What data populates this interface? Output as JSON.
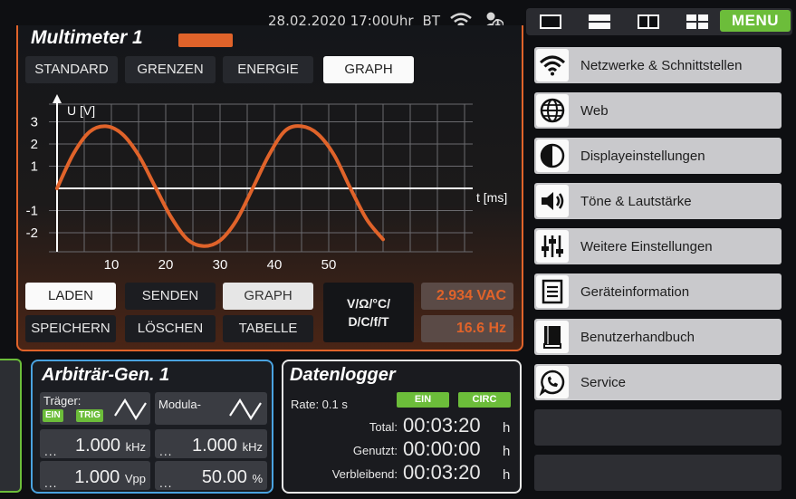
{
  "status": {
    "datetime": "28.02.2020  17:00Uhr",
    "bt": "BT",
    "user_badge": "1"
  },
  "menu_label": "MENU",
  "multimeter": {
    "title": "Multimeter 1",
    "tabs": [
      {
        "label": "STANDARD",
        "active": false
      },
      {
        "label": "GRENZEN",
        "active": false
      },
      {
        "label": "ENERGIE",
        "active": false
      },
      {
        "label": "GRAPH",
        "active": true
      }
    ],
    "graph": {
      "ylabel": "U [V]",
      "xlabel": "t [ms]",
      "y_ticks": [
        "3",
        "2",
        "1",
        "-1",
        "-2"
      ],
      "x_ticks": [
        "10",
        "20",
        "30",
        "40",
        "50"
      ]
    },
    "buttons": {
      "laden": "LADEN",
      "senden": "SENDEN",
      "graph": "GRAPH",
      "speichern": "SPEICHERN",
      "loeschen": "LÖSCHEN",
      "tabelle": "TABELLE"
    },
    "unit_select": [
      "V/Ω/°C/",
      "D/C/f/T"
    ],
    "reading_1": "2.934 VAC",
    "reading_2": "16.6 Hz"
  },
  "chart_data": {
    "type": "line",
    "xlabel": "t [ms]",
    "ylabel": "U [V]",
    "x_ticks": [
      10,
      20,
      30,
      40,
      50
    ],
    "y_ticks": [
      3,
      2,
      1,
      -1,
      -2
    ],
    "series": [
      {
        "x": [
          0,
          3,
          6,
          9,
          12,
          15,
          18,
          21,
          24,
          27,
          30,
          33,
          36,
          39,
          42,
          45,
          48,
          51,
          54,
          57,
          60
        ],
        "values": [
          0,
          1.55,
          2.55,
          2.8,
          2.45,
          1.5,
          0.1,
          -1.3,
          -2.3,
          -2.6,
          -2.35,
          -1.45,
          0,
          1.5,
          2.6,
          2.8,
          2.45,
          1.5,
          0,
          -1.4,
          -2.3
        ]
      }
    ]
  },
  "arb_gen": {
    "title": "Arbiträr-Gen. 1",
    "traeger_label": "Träger:",
    "ein": "EIN",
    "trig": "TRIG",
    "modula_label": "Modula-",
    "freq1": "1.000",
    "freq1_unit": "kHz",
    "freq2": "1.000",
    "freq2_unit": "kHz",
    "amp": "1.000",
    "amp_unit": "Vpp",
    "pct": "50.00",
    "pct_unit": "%",
    "dots": "..."
  },
  "datalogger": {
    "title": "Datenlogger",
    "rate": "Rate: 0.1 s",
    "ein": "EIN",
    "circ": "CIRC",
    "rows": [
      {
        "label": "Total:",
        "value": "00:03:20",
        "unit": "h"
      },
      {
        "label": "Genutzt:",
        "value": "00:00:00",
        "unit": "h"
      },
      {
        "label": "Verbleibend:",
        "value": "00:03:20",
        "unit": "h"
      }
    ]
  },
  "menu_items": [
    {
      "label": "Netzwerke & Schnittstellen",
      "icon": "wifi-icon"
    },
    {
      "label": "Web",
      "icon": "globe-icon"
    },
    {
      "label": "Displayeinstellungen",
      "icon": "contrast-icon"
    },
    {
      "label": "Töne & Lautstärke",
      "icon": "speaker-icon"
    },
    {
      "label": "Weitere Einstellungen",
      "icon": "sliders-icon"
    },
    {
      "label": "Geräteinformation",
      "icon": "document-icon"
    },
    {
      "label": "Benutzerhandbuch",
      "icon": "book-icon"
    },
    {
      "label": "Service",
      "icon": "whatsapp-icon"
    }
  ],
  "colors": {
    "accent_orange": "#e0632a",
    "accent_green": "#6cbd3a",
    "accent_blue": "#4aa3e0"
  }
}
